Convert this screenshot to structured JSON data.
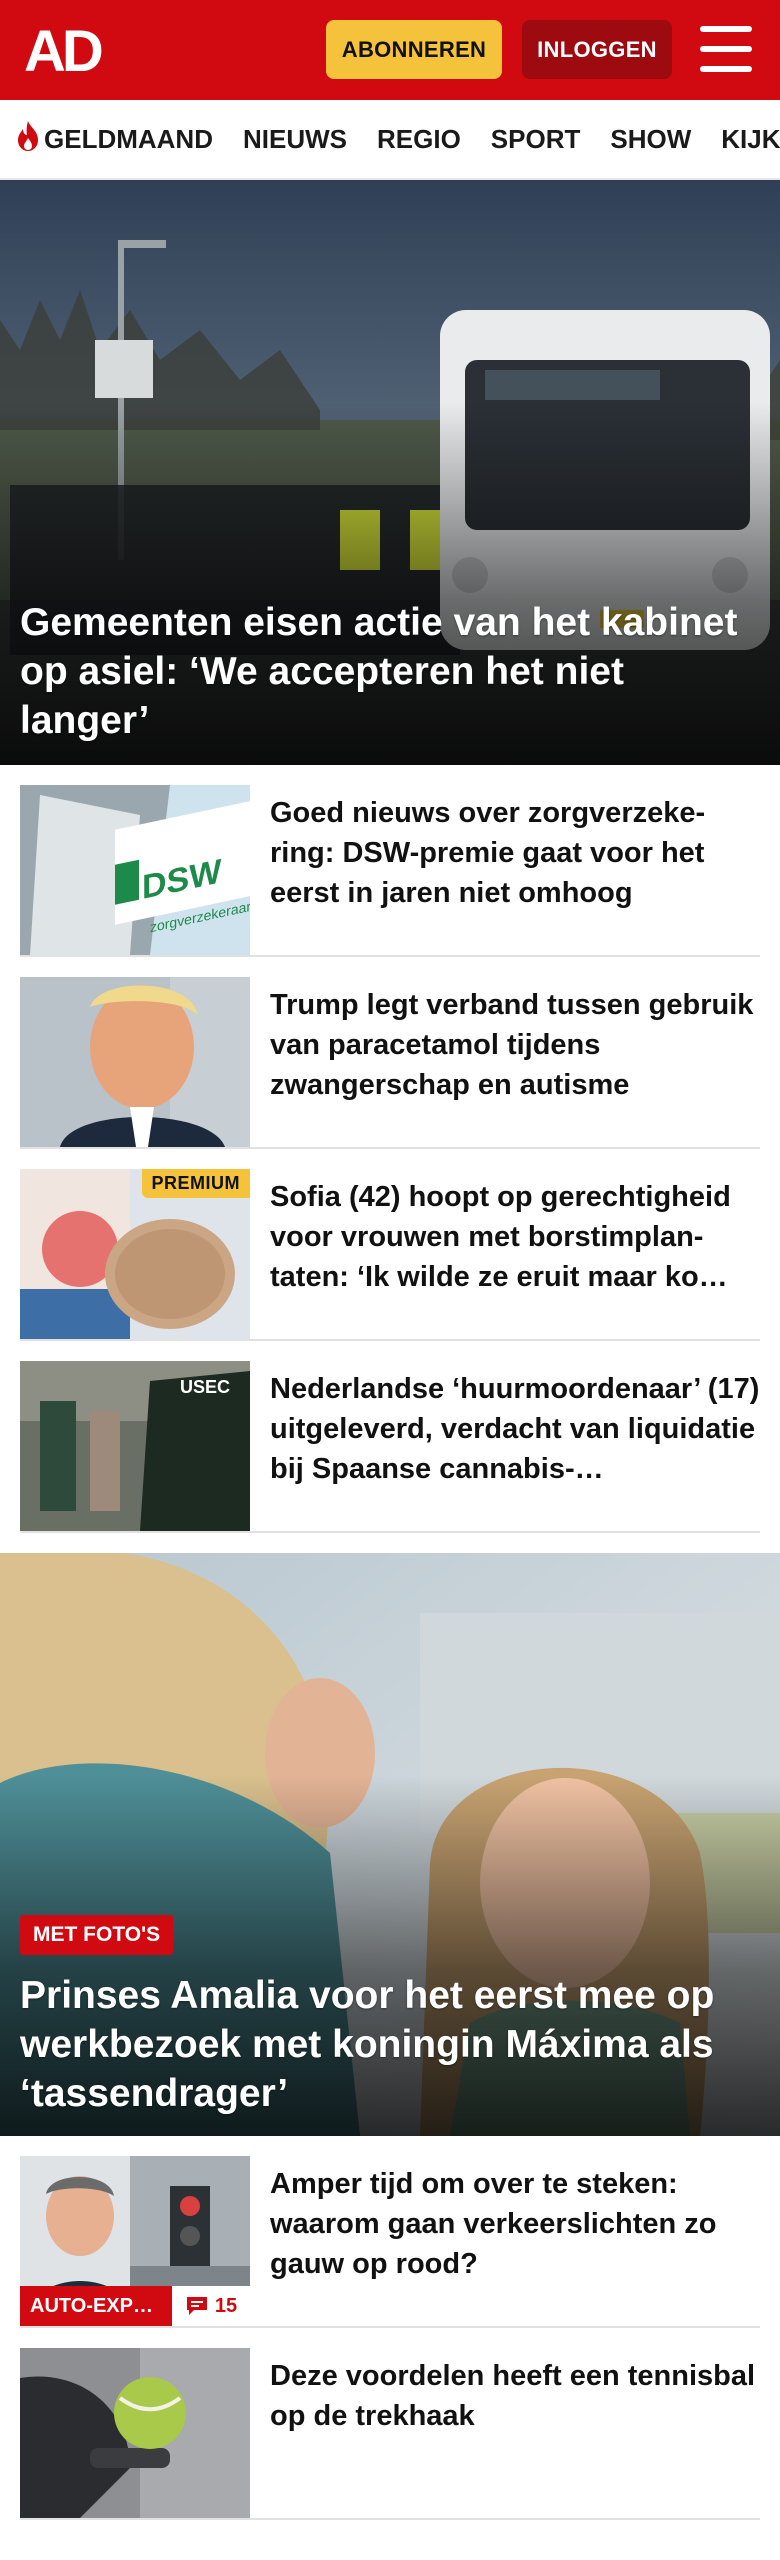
{
  "brand": {
    "logo_text": "AD",
    "color_primary": "#d10a11",
    "color_accent": "#f5c23b"
  },
  "header": {
    "subscribe_label": "ABONNEREN",
    "login_label": "INLOGGEN",
    "menu_icon": "hamburger-menu-icon"
  },
  "nav": {
    "items": [
      {
        "label": "GELDMAAND",
        "icon": "flame-icon"
      },
      {
        "label": "NIEUWS"
      },
      {
        "label": "REGIO"
      },
      {
        "label": "SPORT"
      },
      {
        "label": "SHOW"
      },
      {
        "label": "KIJK"
      }
    ]
  },
  "hero1": {
    "title": "Gemeenten eisen actie van het kabinet op asiel: ‘We accepteren het niet langer’"
  },
  "articles1": [
    {
      "title": "Goed nieuws over zorgverzeke-ring: DSW-premie gaat voor het eerst in jaren niet omhoog",
      "thumb_text": "DSW",
      "thumb_subtext": "zorgverzekeraar"
    },
    {
      "title": "Trump legt verband tussen gebruik van paracetamol tijdens zwangerschap en autisme"
    },
    {
      "title": "Sofia (42) hoopt op gerechtigheid voor vrouwen met borstimplan-taten: ‘Ik wilde ze eruit maar ko…",
      "badge": "PREMIUM"
    },
    {
      "title": "Nederlandse ‘huurmoordenaar’ (17) uitgeleverd, verdacht van liquidatie bij Spaanse cannabis-…",
      "thumb_text": "USEC"
    }
  ],
  "hero2": {
    "label": "MET FOTO'S",
    "title": "Prinses Amalia voor het eerst mee op werkbezoek met koningin Máxima als ‘tassendrager’"
  },
  "articles2": [
    {
      "title": "Amper tijd om over te steken: waarom gaan verkeerslichten zo gauw op rood?",
      "badge": "AUTO-EXP…",
      "comments": "15",
      "comment_icon": "comment-icon"
    },
    {
      "title": "Deze voordelen heeft een tennisbal op de trekhaak"
    }
  ]
}
